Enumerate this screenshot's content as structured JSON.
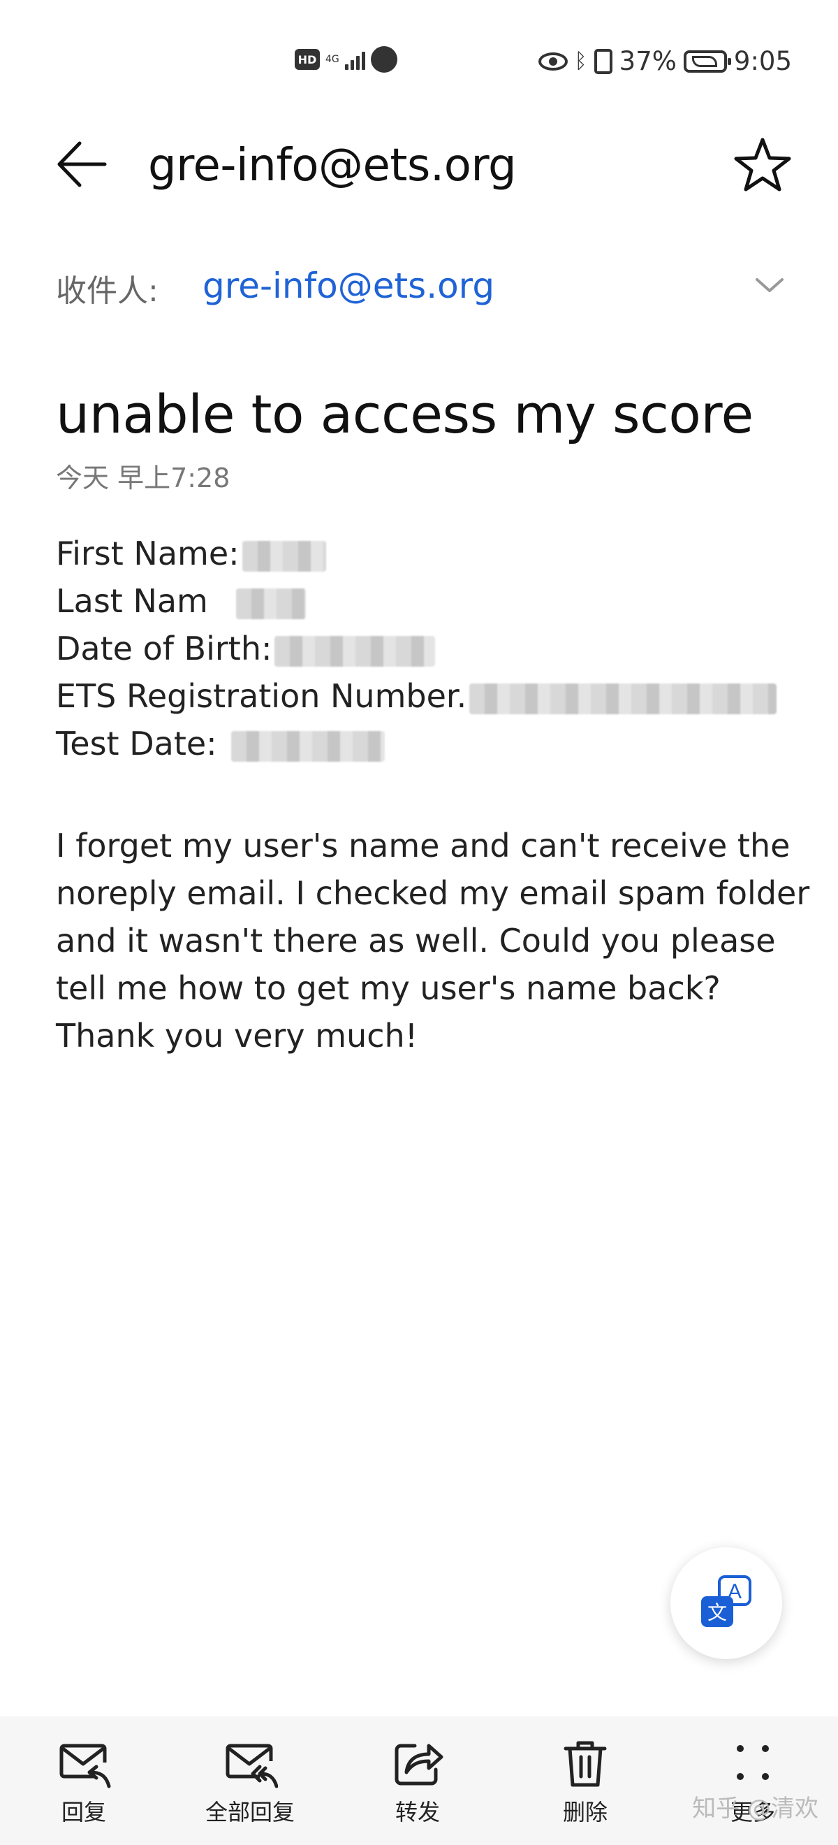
{
  "status_bar": {
    "hd": "HD",
    "network": "4G",
    "battery_percent": "37%",
    "time": "9:05"
  },
  "header": {
    "title": "gre-info@ets.org",
    "back_icon": "arrow-left-icon",
    "star_icon": "star-outline-icon"
  },
  "recipient": {
    "label": "收件人:",
    "value": "gre-info@ets.org",
    "expand_icon": "chevron-down-icon"
  },
  "message": {
    "subject": "unable to access my score",
    "date": "今天 早上7:28",
    "fields": [
      {
        "label": "First Name:"
      },
      {
        "label": "Last Nam"
      },
      {
        "label": "Date of Birth:"
      },
      {
        "label": "ETS Registration Number."
      },
      {
        "label": "Test Date:"
      }
    ],
    "body_lines": [
      "I forget my user's name and can't receive the",
      "noreply email. I checked my email spam folder",
      "and it wasn't there as well. Could you please",
      "tell me how to get my user's name back?",
      "Thank you very much!"
    ]
  },
  "translate_button": {
    "icon": "translate-icon",
    "glyph_a": "A",
    "glyph_wen": "文"
  },
  "toolbar": {
    "items": [
      {
        "label": "回复",
        "icon": "reply-mail-icon"
      },
      {
        "label": "全部回复",
        "icon": "reply-all-mail-icon"
      },
      {
        "label": "转发",
        "icon": "forward-icon"
      },
      {
        "label": "删除",
        "icon": "trash-icon"
      },
      {
        "label": "更多",
        "icon": "more-dots-icon"
      }
    ]
  },
  "watermark": "知乎 @清欢",
  "colors": {
    "link_blue": "#1f63d6",
    "translate_blue": "#1a5fd6",
    "toolbar_bg": "#f6f6f6"
  }
}
